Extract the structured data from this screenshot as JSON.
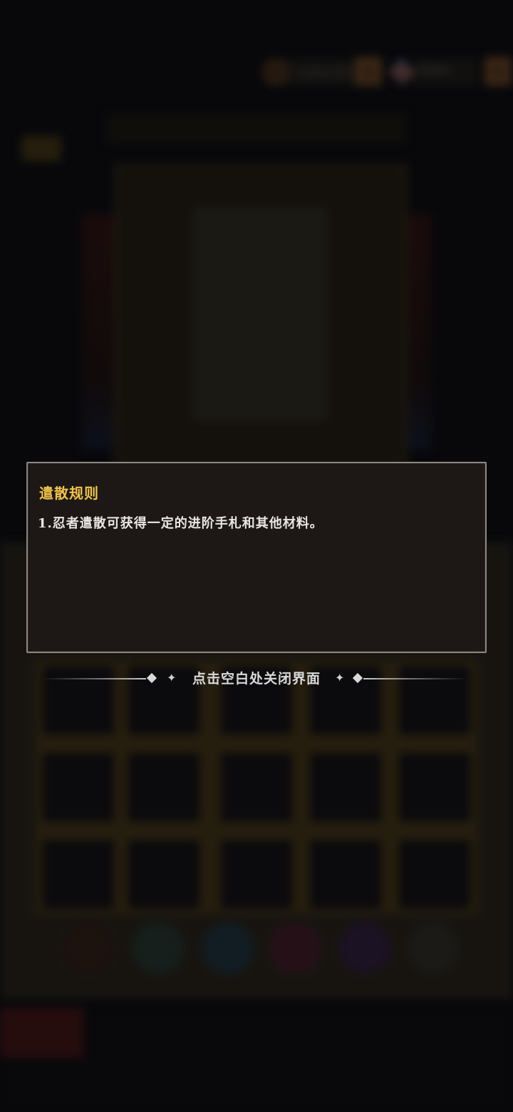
{
  "header": {
    "coin_amount": "1593.6万",
    "gem_amount": "4960",
    "coin_icon": "coin-icon",
    "gem_icon": "gem-icon",
    "plus_icon": "plus-icon"
  },
  "dialog": {
    "title": "遣散规则",
    "rules": [
      "1.忍者遣散可获得一定的进阶手札和其他材料。"
    ]
  },
  "close_hint": {
    "text": "点击空白处关闭界面"
  },
  "colors": {
    "title_gold": "#f0c24e",
    "dialog_bg": "#1d1816",
    "dialog_border": "#8c8783"
  }
}
